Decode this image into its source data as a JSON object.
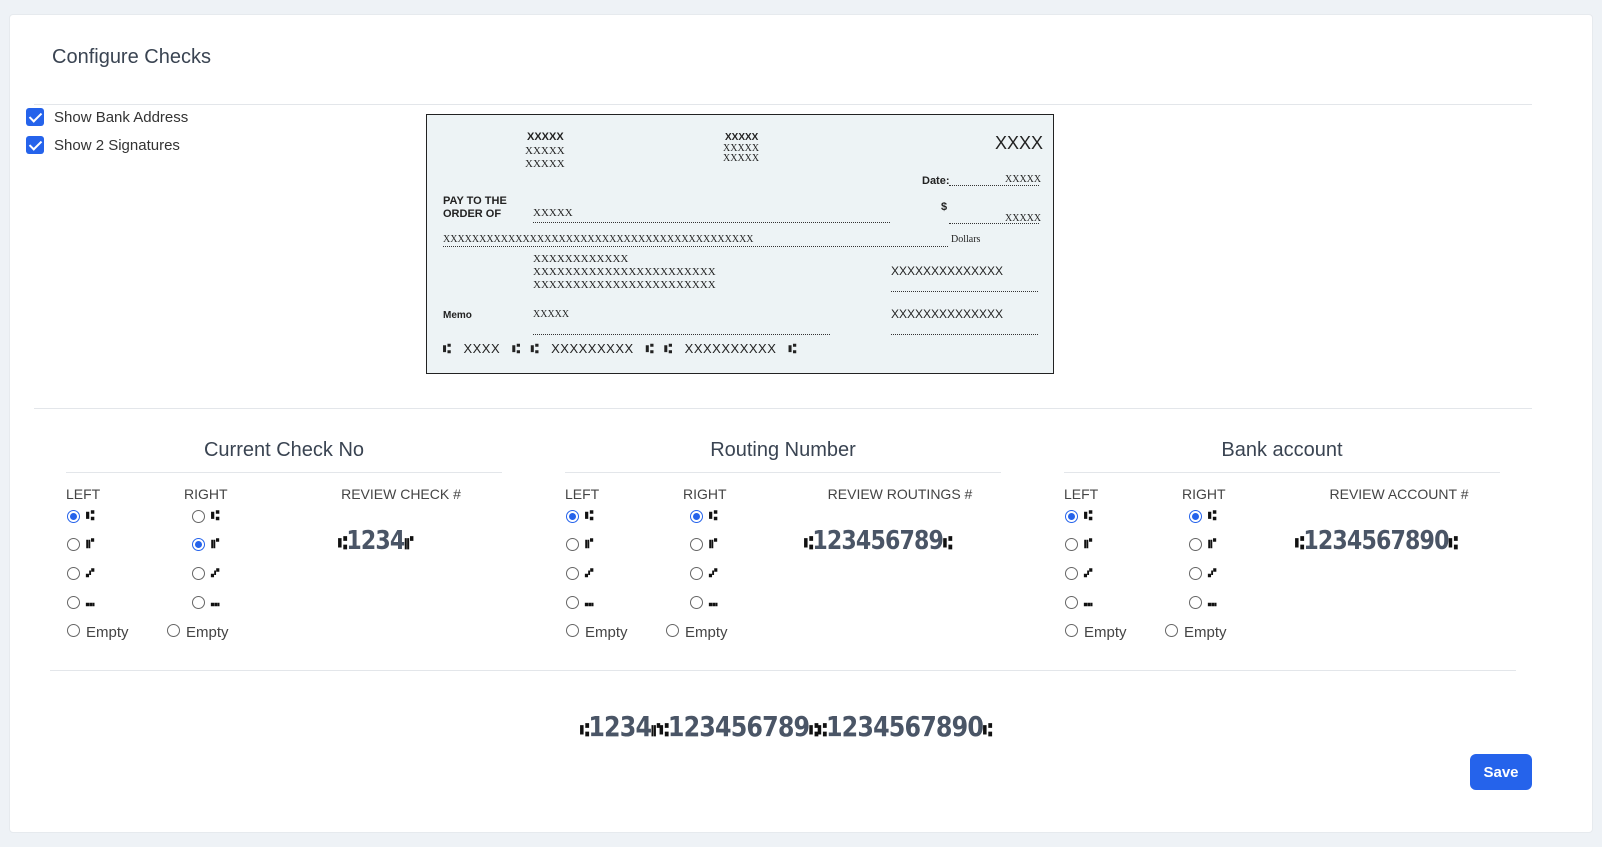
{
  "page": {
    "title": "Configure Checks"
  },
  "options": [
    {
      "label": "Show Bank Address",
      "checked": true
    },
    {
      "label": "Show 2 Signatures",
      "checked": true
    }
  ],
  "check": {
    "bank_name": "XXXXX",
    "bank_line1": "XXXXX",
    "bank_line2": "XXXXX",
    "co_name": "XXXXX",
    "co_line1": "XXXXX",
    "co_line2": "XXXXX",
    "check_no": "XXXX",
    "date_label": "Date:",
    "date_value": "XXXXX",
    "pay_label_1": "PAY TO THE",
    "pay_label_2": "ORDER OF",
    "payee": "XXXXX",
    "dollar_sign": "$",
    "amount": "XXXXX",
    "amount_words": "XXXXXXXXXXXXXXXXXXXXXXXXXXXXXXXXXXXXXXXXXXX",
    "dollars_label": "Dollars",
    "addr1": "XXXXXXXXXXXX",
    "addr2": "XXXXXXXXXXXXXXXXXXXXXXX",
    "addr3": "XXXXXXXXXXXXXXXXXXXXXXX",
    "sig1": "XXXXXXXXXXXXXX",
    "sig2": "XXXXXXXXXXXXXX",
    "memo_label": "Memo",
    "memo_value": "XXXXX",
    "micr_check": "XXXX",
    "micr_routing": "XXXXXXXXX",
    "micr_account": "XXXXXXXXXX"
  },
  "sections": [
    {
      "title": "Current Check No",
      "left_label": "LEFT",
      "right_label": "RIGHT",
      "review_label": "REVIEW CHECK #",
      "preview": "1234",
      "left_selected": 0,
      "right_selected": 1
    },
    {
      "title": "Routing Number",
      "left_label": "LEFT",
      "right_label": "RIGHT",
      "review_label": "REVIEW ROUTINGS #",
      "preview": "123456789",
      "left_selected": 0,
      "right_selected": 0
    },
    {
      "title": "Bank account",
      "left_label": "LEFT",
      "right_label": "RIGHT",
      "review_label": "REVIEW ACCOUNT #",
      "preview": "1234567890",
      "left_selected": 0,
      "right_selected": 0
    }
  ],
  "symbols": [
    "⑆",
    "⑈",
    "⑇",
    "⑉"
  ],
  "empty_label": "Empty",
  "combined": {
    "check": "1234",
    "routing": "123456789",
    "account": "1234567890"
  },
  "save_label": "Save"
}
